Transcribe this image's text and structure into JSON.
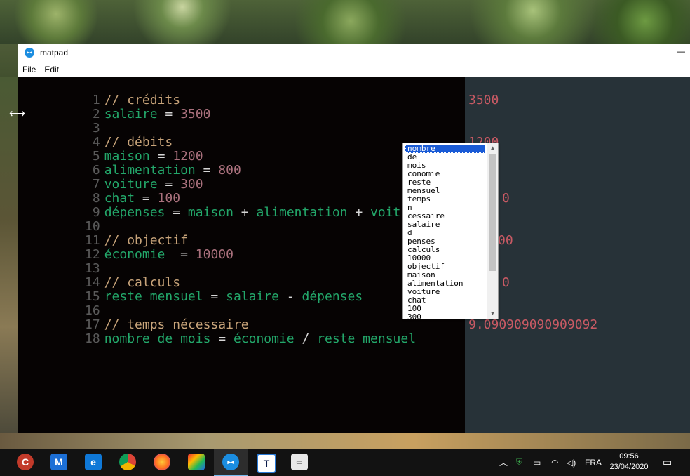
{
  "window": {
    "title": "matpad"
  },
  "menu": {
    "file": "File",
    "edit": "Edit"
  },
  "code_lines": [
    {
      "n": "1",
      "text": "// crédits"
    },
    {
      "n": "2",
      "text": "salaire = 3500"
    },
    {
      "n": "3",
      "text": ""
    },
    {
      "n": "4",
      "text": "// débits"
    },
    {
      "n": "5",
      "text": "maison = 1200"
    },
    {
      "n": "6",
      "text": "alimentation = 800"
    },
    {
      "n": "7",
      "text": "voiture = 300"
    },
    {
      "n": "8",
      "text": "chat = 100"
    },
    {
      "n": "9",
      "text": "dépenses = maison + alimentation + voiture"
    },
    {
      "n": "10",
      "text": ""
    },
    {
      "n": "11",
      "text": "// objectif"
    },
    {
      "n": "12",
      "text": "économie  = 10000"
    },
    {
      "n": "13",
      "text": ""
    },
    {
      "n": "14",
      "text": "// calculs"
    },
    {
      "n": "15",
      "text": "reste mensuel = salaire - dépenses"
    },
    {
      "n": "16",
      "text": ""
    },
    {
      "n": "17",
      "text": "// temps nécessaire"
    },
    {
      "n": "18",
      "text": "nombre de mois = économie / reste mensuel"
    }
  ],
  "results": {
    "line2": "3500",
    "line5": "1200",
    "line9": "0",
    "line12": "00",
    "line15": "0",
    "line18": "9.090909090909092"
  },
  "autocomplete": {
    "items": [
      "nombre",
      "de",
      "mois",
      "conomie",
      "reste",
      "mensuel",
      "temps",
      "n",
      "cessaire",
      "salaire",
      "d",
      "penses",
      "calculs",
      "10000",
      "objectif",
      "maison",
      "alimentation",
      "voiture",
      "chat",
      "100",
      "300"
    ],
    "selected": "nombre"
  },
  "taskbar": {
    "language": "FRA",
    "time": "09:56",
    "date": "23/04/2020",
    "apps": [
      "ccleaner-icon",
      "malwarebytes-icon",
      "edge-icon",
      "chrome-icon",
      "firefox-icon",
      "paint-icon",
      "matpad-icon",
      "typora-icon",
      "remote-desktop-icon"
    ]
  },
  "colors": {
    "code_bg": "#060303",
    "result_bg": "#273238",
    "comment": "#c8a47a",
    "variable": "#23a76a",
    "number": "#a9707c",
    "result": "#c95a64"
  }
}
